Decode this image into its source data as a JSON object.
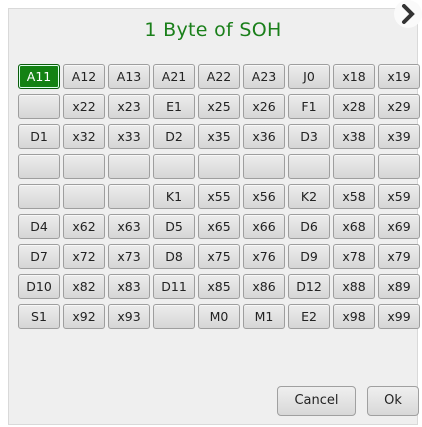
{
  "dialog": {
    "title": "1 Byte of SOH",
    "cancel_label": "Cancel",
    "ok_label": "Ok",
    "accent_color": "#138213"
  },
  "grid": {
    "selected": "A11",
    "rows": [
      [
        "A11",
        "A12",
        "A13",
        "A21",
        "A22",
        "A23",
        "J0",
        "x18",
        "x19"
      ],
      [
        "",
        "x22",
        "x23",
        "E1",
        "x25",
        "x26",
        "F1",
        "x28",
        "x29"
      ],
      [
        "D1",
        "x32",
        "x33",
        "D2",
        "x35",
        "x36",
        "D3",
        "x38",
        "x39"
      ],
      [
        "",
        "",
        "",
        "",
        "",
        "",
        "",
        "",
        ""
      ],
      [
        "",
        "",
        "",
        "K1",
        "x55",
        "x56",
        "K2",
        "x58",
        "x59"
      ],
      [
        "D4",
        "x62",
        "x63",
        "D5",
        "x65",
        "x66",
        "D6",
        "x68",
        "x69"
      ],
      [
        "D7",
        "x72",
        "x73",
        "D8",
        "x75",
        "x76",
        "D9",
        "x78",
        "x79"
      ],
      [
        "D10",
        "x82",
        "x83",
        "D11",
        "x85",
        "x86",
        "D12",
        "x88",
        "x89"
      ],
      [
        "S1",
        "x92",
        "x93",
        "",
        "M0",
        "M1",
        "E2",
        "x98",
        "x99"
      ]
    ]
  }
}
